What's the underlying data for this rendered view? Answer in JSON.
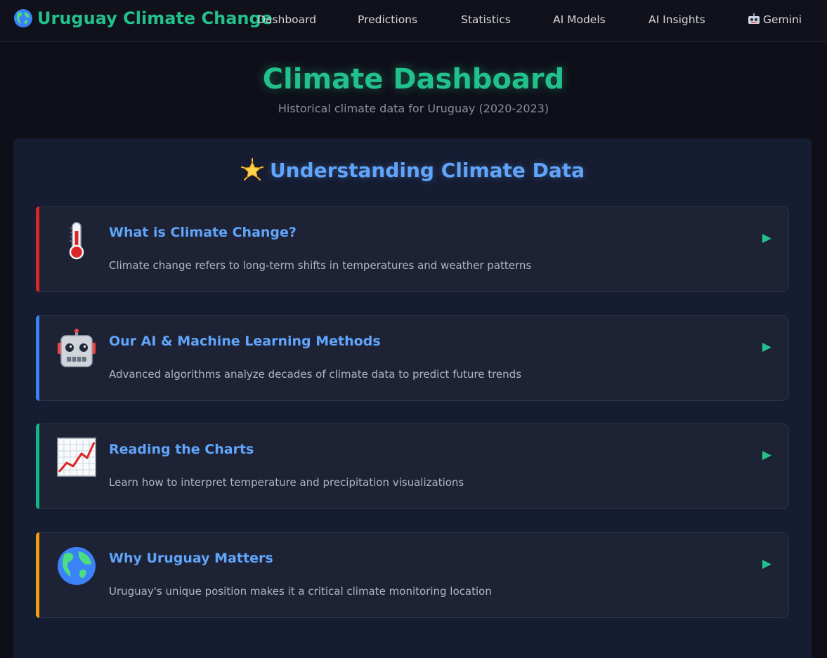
{
  "nav": {
    "brand": "Uruguay Climate Change",
    "items": [
      "Dashboard",
      "Predictions",
      "Statistics",
      "AI Models",
      "AI Insights",
      "Gemini"
    ]
  },
  "header": {
    "title": "Climate Dashboard",
    "subtitle": "Historical climate data for Uruguay (2020-2023)"
  },
  "panel": {
    "title": "Understanding Climate Data",
    "cards": [
      {
        "title": "What is Climate Change?",
        "description": "Climate change refers to long-term shifts in temperatures and weather patterns",
        "icon": "thermometer-icon",
        "accent": "#ef4444"
      },
      {
        "title": "Our AI & Machine Learning Methods",
        "description": "Advanced algorithms analyze decades of climate data to predict future trends",
        "icon": "robot-icon",
        "accent": "#3b82f6"
      },
      {
        "title": "Reading the Charts",
        "description": "Learn how to interpret temperature and precipitation visualizations",
        "icon": "chart-increasing-icon",
        "accent": "#10b981"
      },
      {
        "title": "Why Uruguay Matters",
        "description": "Uruguay's unique position makes it a critical climate monitoring location",
        "icon": "globe-icon",
        "accent": "#f59e0b"
      }
    ]
  },
  "colors": {
    "brand": "#22c08a",
    "heading_blue": "#60a5fa",
    "background": "#0f0f19",
    "panel": "#161c31",
    "card": "#1e2235"
  }
}
